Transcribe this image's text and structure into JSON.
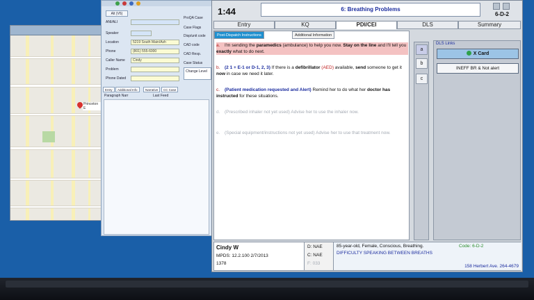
{
  "header": {
    "time": "1:44",
    "protocol_title": "6: Breathing Problems",
    "determinant_code": "6-D-2"
  },
  "tabs": [
    {
      "label": "Entry"
    },
    {
      "label": "KQ"
    },
    {
      "label": "PDI/CEI"
    },
    {
      "label": "DLS"
    },
    {
      "label": "Summary"
    }
  ],
  "subtabs": {
    "active": "Post-Dispatch Instructions",
    "other": "Additional Information"
  },
  "instructions": {
    "a": {
      "letter": "a.",
      "t1": "I'm sending the ",
      "bold1": "paramedics",
      "t2": " (ambulance) to help you now. ",
      "bold2": "Stay on the line",
      "t3": " and I'll tell you ",
      "bold3": "exactly",
      "t4": " what to do next."
    },
    "b": {
      "letter": "b.",
      "blue": "(2 1 + E-1 or D-1, 2, 3)",
      "t1": " If there is a ",
      "bold1": "defibrillator",
      "red": " (AED)",
      "t2": " available, ",
      "bold2": "send",
      "t3": " someone to get it ",
      "bold3": "now",
      "t4": " in case we need it later."
    },
    "c": {
      "letter": "c.",
      "blue": "(Patient medication requested and Alert)",
      "t1": " Remind her to do what her ",
      "bold1": "doctor has instructed",
      "t2": " for these situations."
    },
    "d": {
      "letter": "d.",
      "text": "(Prescribed inhaler not yet used) Advise her to use the inhaler now."
    },
    "e": {
      "letter": "e.",
      "text": "(Special equipment/instructions not yet used) Advise her to use that treatment now."
    }
  },
  "letter_buttons": [
    "a",
    "b",
    "c"
  ],
  "dls": {
    "title": "DLS Links",
    "xcard_label": "X Card",
    "ineff_label": "INEFF BR & Not alert"
  },
  "caller": {
    "name": "Cindy W",
    "meta": "MPDS: 12.2.100  2/7/2013",
    "id": "1378"
  },
  "codes": {
    "d": "D: NAE",
    "c": "C: NAE",
    "f": "F: 033"
  },
  "summary": {
    "text": "85-year-old, Female, Conscious, Breathing.",
    "code": "Code: 6-D-2",
    "sub": "DIFFICULTY SPEAKING BETWEEN BREATHS",
    "address": "158 Herbert Ave. 264-4679"
  },
  "form": {
    "tab": "Alt (V6)",
    "labels": [
      "ANI/ALI",
      "Speaker",
      "Location",
      "Phone",
      "Caller Name",
      "Problem",
      "Phone Dated"
    ],
    "values": [
      "",
      "",
      "5219 South Main/Ash",
      "(801) 555-6000",
      "Cindy",
      "",
      ""
    ],
    "side_labels": [
      "ProQA Case",
      "Case Flags",
      "Disp/unit code",
      "CAD code",
      "CAD Resp.",
      "Case Status",
      "Change Level"
    ],
    "small_tabs": [
      "Entry",
      "Additional Info",
      "Narrative",
      "CC Case"
    ],
    "checkbox_labels": [
      "Paragraph Narr",
      "Last Feed"
    ]
  },
  "map": {
    "pin_label": "Princeton E"
  },
  "colors": {
    "accent": "#1d8fcf",
    "highlight": "#f4c2c2",
    "link_blue": "#1a2b9e",
    "code_green": "#2a8c2a"
  }
}
